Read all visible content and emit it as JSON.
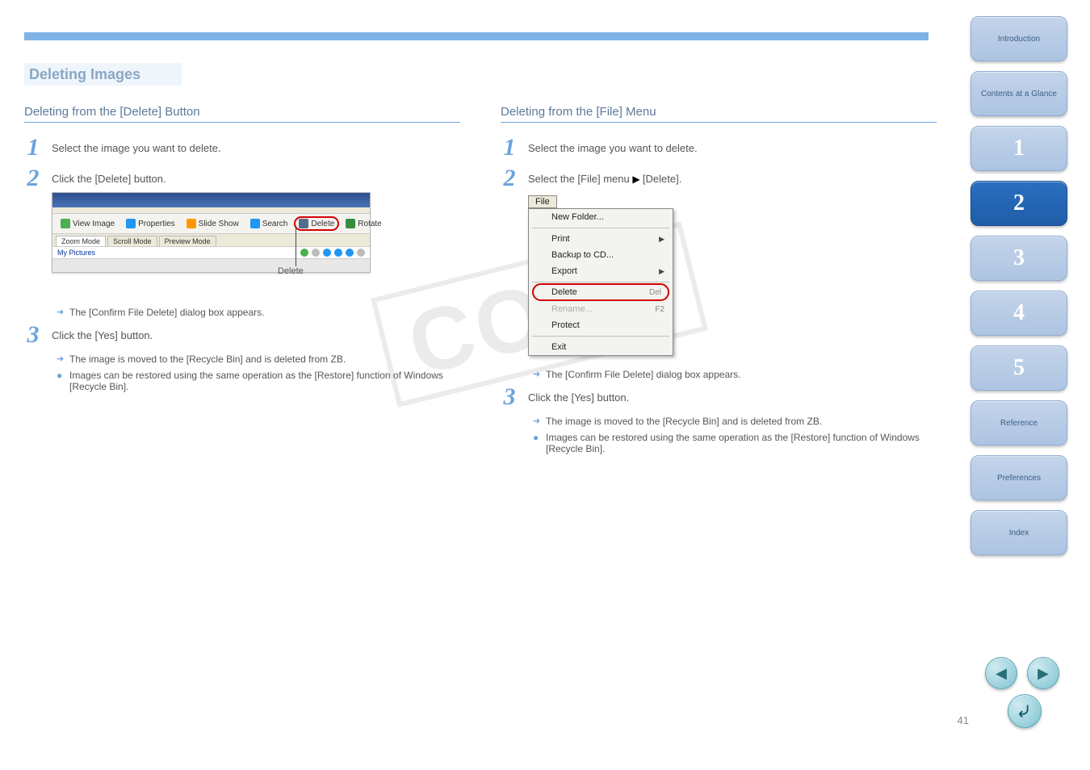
{
  "page": {
    "title": "Deleting Images",
    "number": "41"
  },
  "left": {
    "section_title": "Deleting from the [Delete] Button",
    "step1": "Select the image you want to delete.",
    "step2": "Click the [Delete] button.",
    "delete_label": "Delete",
    "result1": "The [Confirm File Delete] dialog box appears.",
    "step3": "Click the [Yes] button.",
    "result3a": "The image is moved to the [Recycle Bin] and is deleted from ZB.",
    "result3b": "Images can be restored using the same operation as the [Restore] function of Windows [Recycle Bin]."
  },
  "right": {
    "section_title": "Deleting from the [File] Menu",
    "step1": "Select the image you want to delete.",
    "step2_a": "Select the [File] menu",
    "step2_b": "[Delete].",
    "result1": "The [Confirm File Delete] dialog box appears.",
    "step3": "Click the [Yes] button.",
    "result3a": "The image is moved to the [Recycle Bin] and is deleted from ZB.",
    "result3b": "Images can be restored using the same operation as the [Restore] function of Windows [Recycle Bin]."
  },
  "toolbar": {
    "buttons": [
      "View Image",
      "Properties",
      "Slide Show",
      "Search",
      "Delete",
      "Rotate"
    ],
    "tabs": [
      "Zoom Mode",
      "Scroll Mode",
      "Preview Mode"
    ],
    "path": "My Pictures"
  },
  "file_menu": {
    "button": "File",
    "items": [
      {
        "label": "New Folder...",
        "type": "normal"
      },
      {
        "type": "sep"
      },
      {
        "label": "Print",
        "type": "sub"
      },
      {
        "label": "Backup to CD...",
        "type": "normal"
      },
      {
        "label": "Export",
        "type": "sub"
      },
      {
        "type": "sep"
      },
      {
        "label": "Delete",
        "shortcut": "Del",
        "type": "highlight"
      },
      {
        "label": "Rename...",
        "shortcut": "F2",
        "type": "disabled"
      },
      {
        "label": "Protect",
        "type": "normal"
      },
      {
        "type": "sep"
      },
      {
        "label": "Exit",
        "type": "normal"
      }
    ]
  },
  "nav": {
    "intro": "Introduction",
    "contents": "Contents at a Glance",
    "chapters": [
      "1",
      "2",
      "3",
      "4",
      "5"
    ],
    "active_chapter": "2",
    "reference": "Reference",
    "preferences": "Preferences",
    "index": "Index"
  },
  "watermark": "COPY"
}
